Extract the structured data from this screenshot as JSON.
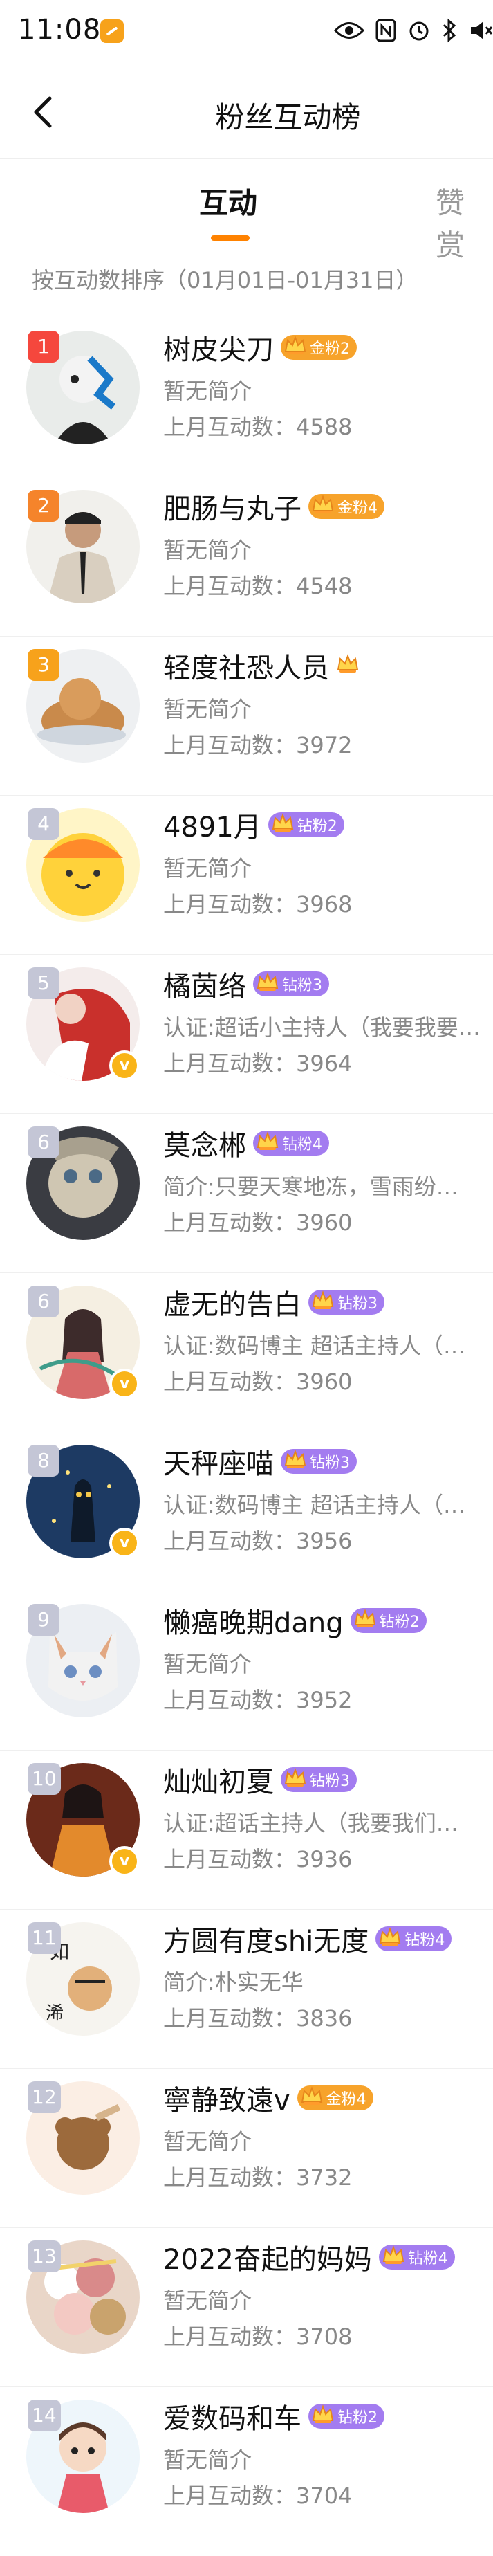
{
  "status_bar": {
    "time": "11:08",
    "icons": [
      "eye-icon",
      "nfc-icon",
      "alarm-icon",
      "bluetooth-icon",
      "mute-icon"
    ]
  },
  "header": {
    "title": "粉丝互动榜",
    "back_icon": "chevron-left-icon"
  },
  "tabs": [
    {
      "label": "互动",
      "active": true
    },
    {
      "label": "赞赏",
      "active": false
    }
  ],
  "sort_note": "按互动数排序（01月01日-01月31日）",
  "colors": {
    "accent": "#ff8200",
    "gold_badge": "#f7a32b",
    "diamond_badge": "#a37cf0",
    "rank_top1": "#f5473d",
    "rank_top2": "#f5842b",
    "rank_top3": "#f7a21b",
    "rank_other": "#c4c6d6"
  },
  "fans": [
    {
      "rank": "1",
      "name": "树皮尖刀",
      "badge": "金粉2",
      "badge_type": "gold",
      "desc": "暂无简介",
      "count_label": "上月互动数：",
      "count": "4588",
      "verified": false
    },
    {
      "rank": "2",
      "name": "肥肠与丸子",
      "badge": "金粉4",
      "badge_type": "gold",
      "desc": "暂无简介",
      "count_label": "上月互动数：",
      "count": "4548",
      "verified": false
    },
    {
      "rank": "3",
      "name": "轻度社恐人员",
      "badge": "",
      "badge_type": "bare",
      "desc": "暂无简介",
      "count_label": "上月互动数：",
      "count": "3972",
      "verified": false
    },
    {
      "rank": "4",
      "name": "4891月",
      "badge": "钻粉2",
      "badge_type": "diamond",
      "desc": "暂无简介",
      "count_label": "上月互动数：",
      "count": "3968",
      "verified": false
    },
    {
      "rank": "5",
      "name": "橘茵络",
      "badge": "钻粉3",
      "badge_type": "diamond",
      "desc": "认证:超话小主持人（我要我要我…",
      "count_label": "上月互动数：",
      "count": "3964",
      "verified": true
    },
    {
      "rank": "6",
      "name": "莫念郴",
      "badge": "钻粉4",
      "badge_type": "diamond",
      "desc": "简介:只要天寒地冻，雪雨纷…",
      "count_label": "上月互动数：",
      "count": "3960",
      "verified": false
    },
    {
      "rank": "6",
      "name": "虚无的告白",
      "badge": "钻粉3",
      "badge_type": "diamond",
      "desc": "认证:数码博主 超话主持人（莎士",
      "count_label": "上月互动数：",
      "count": "3960",
      "verified": true
    },
    {
      "rank": "8",
      "name": "天秤座喵",
      "badge": "钻粉3",
      "badge_type": "diamond",
      "desc": "认证:数码博主 超话主持人（歌德",
      "count_label": "上月互动数：",
      "count": "3956",
      "verified": true
    },
    {
      "rank": "9",
      "name": "懒癌晚期dang",
      "badge": "钻粉2",
      "badge_type": "diamond",
      "desc": "暂无简介",
      "count_label": "上月互动数：",
      "count": "3952",
      "verified": false
    },
    {
      "rank": "10",
      "name": "灿灿初夏",
      "badge": "钻粉3",
      "badge_type": "diamond",
      "desc": "认证:超话主持人（我要我们…",
      "count_label": "上月互动数：",
      "count": "3936",
      "verified": true
    },
    {
      "rank": "11",
      "name": "方圆有度shi无度",
      "badge": "钻粉4",
      "badge_type": "diamond",
      "desc": "简介:朴实无华",
      "count_label": "上月互动数：",
      "count": "3836",
      "verified": false
    },
    {
      "rank": "12",
      "name": "寧静致遠v",
      "badge": "金粉4",
      "badge_type": "gold",
      "desc": "暂无简介",
      "count_label": "上月互动数：",
      "count": "3732",
      "verified": false
    },
    {
      "rank": "13",
      "name": "2022奋起的妈妈",
      "badge": "钻粉4",
      "badge_type": "diamond",
      "desc": "暂无简介",
      "count_label": "上月互动数：",
      "count": "3708",
      "verified": false
    },
    {
      "rank": "14",
      "name": "爱数码和车",
      "badge": "钻粉2",
      "badge_type": "diamond",
      "desc": "暂无简介",
      "count_label": "上月互动数：",
      "count": "3704",
      "verified": false
    }
  ]
}
